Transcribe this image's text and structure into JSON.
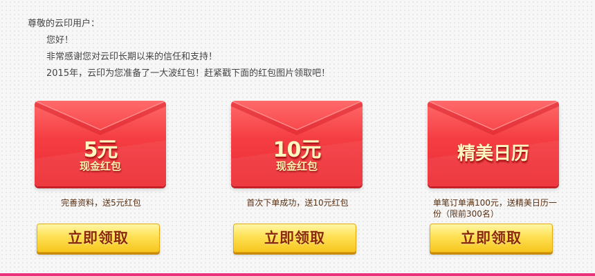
{
  "intro": {
    "greeting": "尊敬的云印用户：",
    "hello": "您好！",
    "thanks": "非常感谢您对云印长期以来的信任和支持！",
    "announcement": "2015年，云印为您准备了一大波红包！赶紧戳下面的红包图片领取吧！"
  },
  "cards": [
    {
      "amount": "5元",
      "subtitle": "现金红包",
      "desc": "完善资料，送5元红包",
      "button": "立即领取"
    },
    {
      "amount": "10元",
      "subtitle": "现金红包",
      "desc": "首次下单成功，送10元红包",
      "button": "立即领取"
    },
    {
      "title": "精美日历",
      "desc": "单笔订单满100元，送精美日历一份（限前300名）",
      "button": "立即领取"
    }
  ],
  "colors": {
    "envelope": "#f43d42",
    "button": "#ffe35a",
    "button_text": "#8a2a0a",
    "accent_bar": "#e8317a"
  }
}
